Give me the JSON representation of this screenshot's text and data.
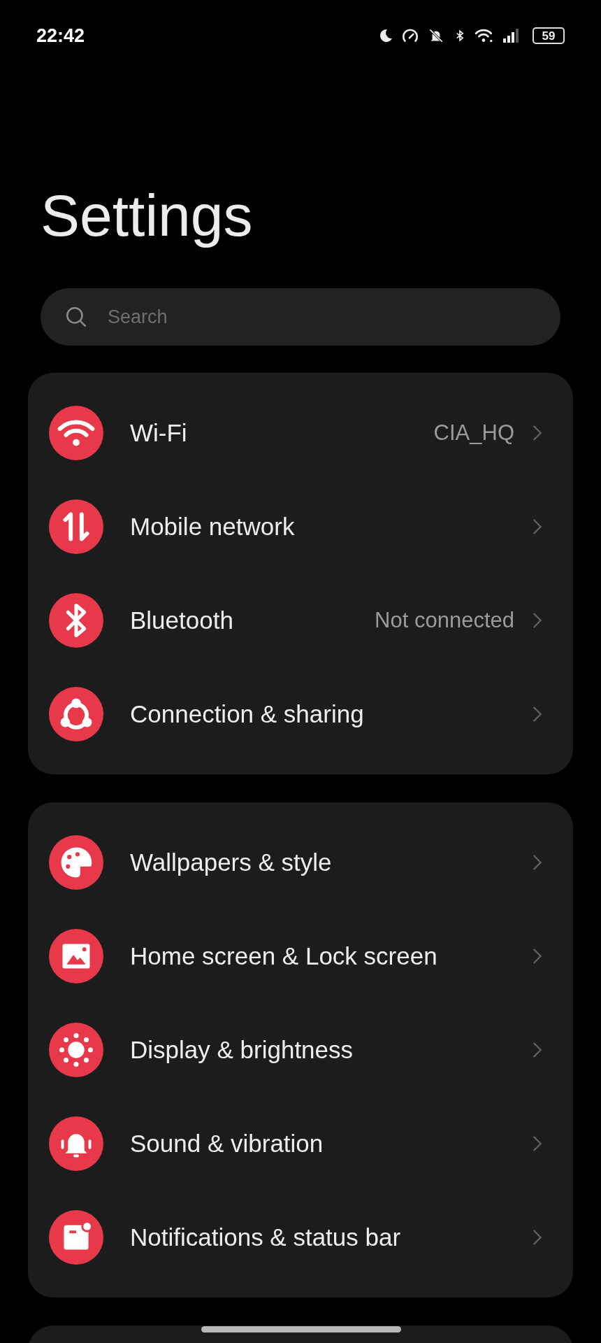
{
  "status_bar": {
    "time": "22:42",
    "battery": "59"
  },
  "title": "Settings",
  "search": {
    "placeholder": "Search"
  },
  "sections": [
    {
      "items": [
        {
          "label": "Wi-Fi",
          "value": "CIA_HQ"
        },
        {
          "label": "Mobile network"
        },
        {
          "label": "Bluetooth",
          "value": "Not connected"
        },
        {
          "label": "Connection & sharing"
        }
      ]
    },
    {
      "items": [
        {
          "label": "Wallpapers & style"
        },
        {
          "label": "Home screen & Lock screen"
        },
        {
          "label": "Display & brightness"
        },
        {
          "label": "Sound & vibration"
        },
        {
          "label": "Notifications & status bar"
        }
      ]
    }
  ]
}
